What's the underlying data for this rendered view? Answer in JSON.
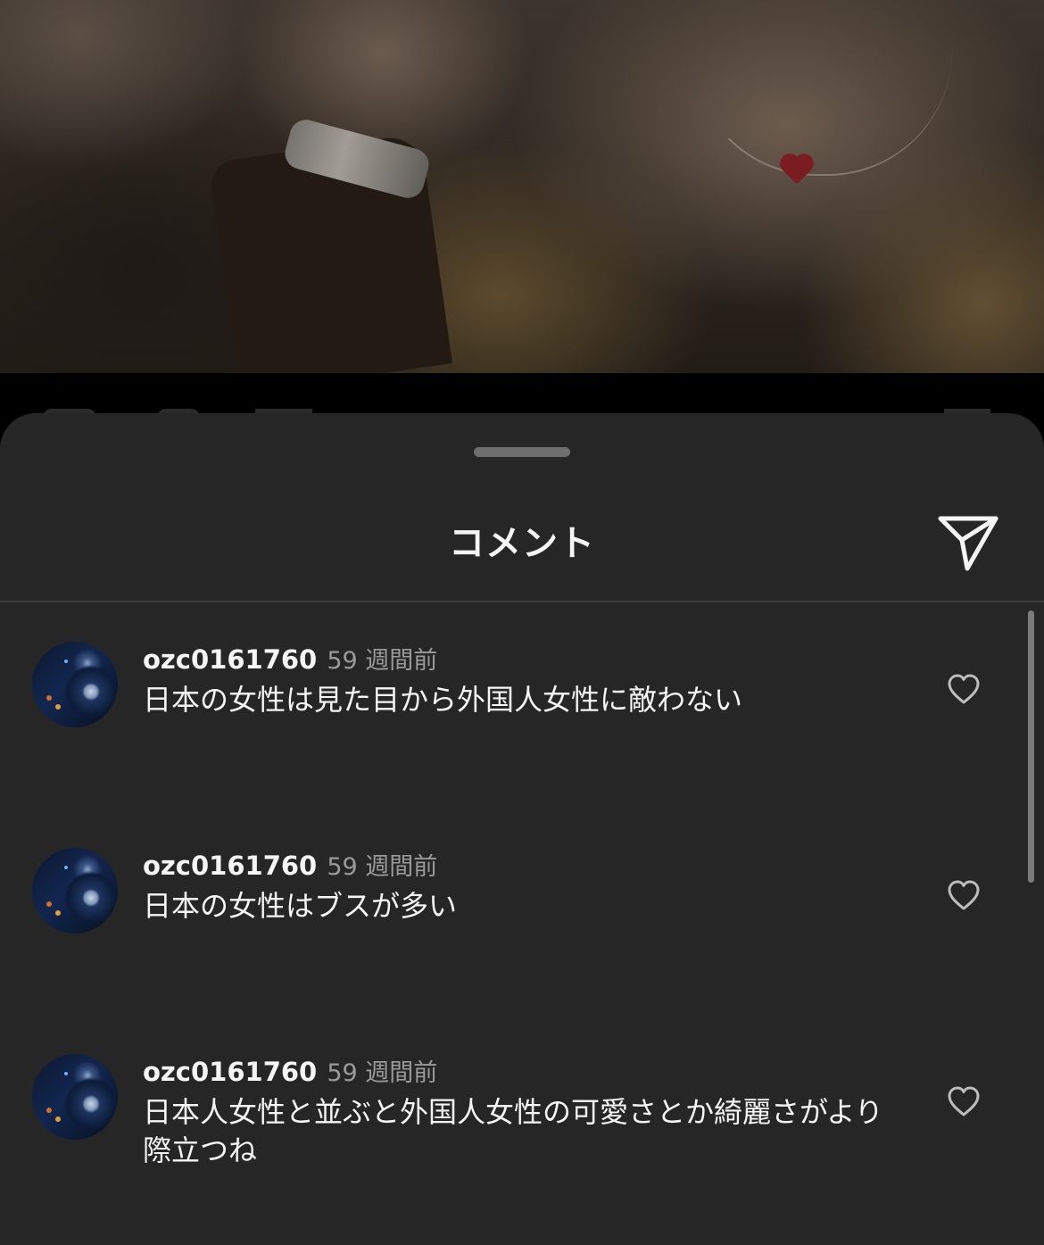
{
  "sheet": {
    "title": "コメント",
    "share_icon": "send-paper-plane-icon"
  },
  "comments": [
    {
      "username": "ozc0161760",
      "time": "59 週間前",
      "text": "日本の女性は見た目から外国人女性に敵わない",
      "like_icon": "heart-outline-icon"
    },
    {
      "username": "ozc0161760",
      "time": "59 週間前",
      "text": "日本の女性はブスが多い",
      "like_icon": "heart-outline-icon"
    },
    {
      "username": "ozc0161760",
      "time": "59 週間前",
      "text": "日本人女性と並ぶと外国人女性の可愛さとか綺麗さがより際立つね",
      "like_icon": "heart-outline-icon"
    }
  ],
  "colors": {
    "sheet_background": "#262626",
    "text_primary": "#f5f5f5",
    "text_secondary": "#9a9a9a"
  }
}
